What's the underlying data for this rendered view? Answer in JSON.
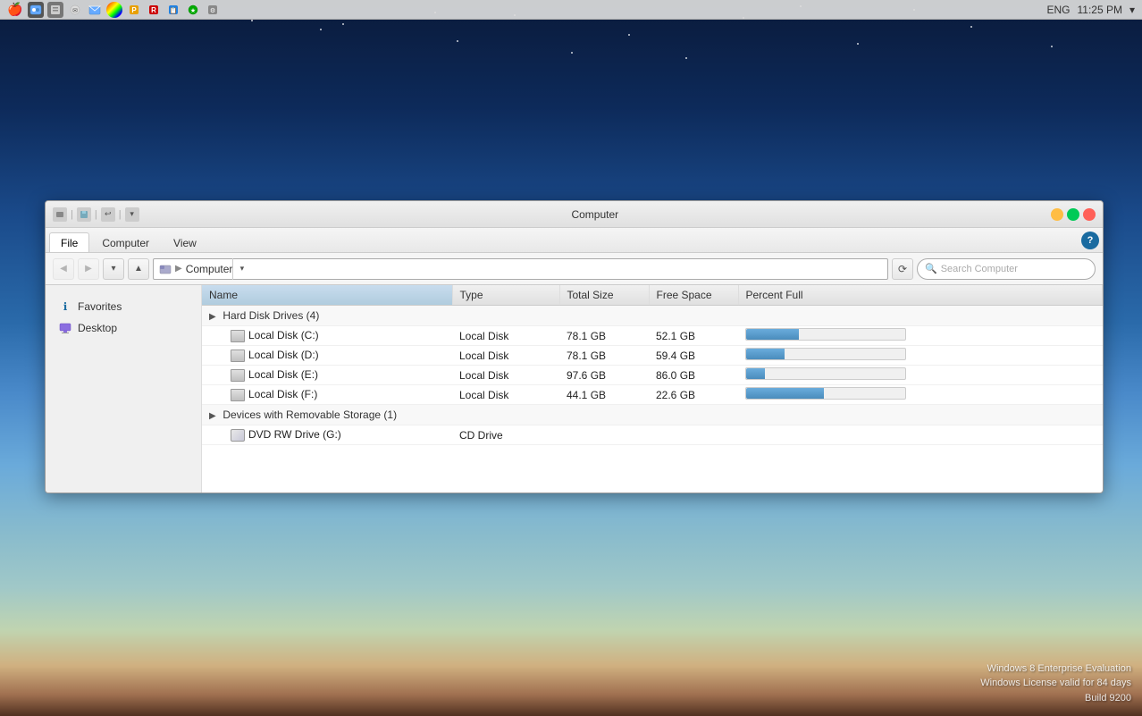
{
  "desktop": {
    "watermark": {
      "line1": "Windows 8 Enterprise Evaluation",
      "line2": "Windows License valid for 84 days",
      "line3": "Build 9200"
    }
  },
  "menubar": {
    "time": "11:25 PM",
    "language": "ENG"
  },
  "window": {
    "title": "Computer",
    "tabs": [
      {
        "label": "File",
        "active": true
      },
      {
        "label": "Computer",
        "active": false
      },
      {
        "label": "View",
        "active": false
      }
    ],
    "address": {
      "path": "Computer",
      "search_placeholder": "Search Computer"
    },
    "sidebar": {
      "sections": [
        {
          "items": [
            {
              "label": "Favorites",
              "icon": "★",
              "type": "favorites"
            },
            {
              "label": "Desktop",
              "icon": "□",
              "type": "desktop"
            }
          ]
        }
      ]
    },
    "table": {
      "columns": [
        "Name",
        "Type",
        "Total Size",
        "Free Space",
        "Percent Full"
      ],
      "groups": [
        {
          "name": "Hard Disk Drives (4)",
          "expanded": true,
          "items": [
            {
              "name": "Local Disk (C:)",
              "type": "Local Disk",
              "total": "78.1 GB",
              "free": "52.1 GB",
              "percent_used": 33
            },
            {
              "name": "Local Disk (D:)",
              "type": "Local Disk",
              "total": "78.1 GB",
              "free": "59.4 GB",
              "percent_used": 24
            },
            {
              "name": "Local Disk (E:)",
              "type": "Local Disk",
              "total": "97.6 GB",
              "free": "86.0 GB",
              "percent_used": 12
            },
            {
              "name": "Local Disk (F:)",
              "type": "Local Disk",
              "total": "44.1 GB",
              "free": "22.6 GB",
              "percent_used": 49
            }
          ]
        },
        {
          "name": "Devices with Removable Storage (1)",
          "expanded": true,
          "items": [
            {
              "name": "DVD RW Drive (G:)",
              "type": "CD Drive",
              "total": "",
              "free": "",
              "percent_used": 0,
              "icon": "dvd"
            }
          ]
        }
      ]
    }
  }
}
